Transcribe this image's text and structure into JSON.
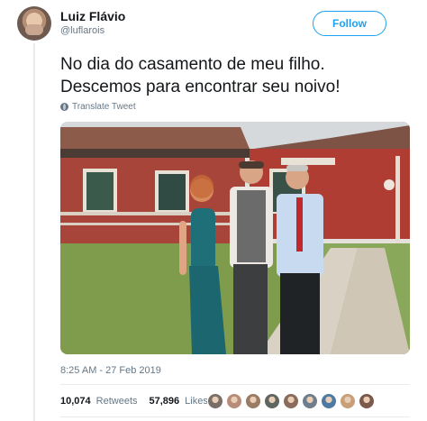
{
  "user": {
    "name": "Luiz Flávio",
    "handle": "@luflarois",
    "follow_label": "Follow"
  },
  "tweet": {
    "text": "No dia do casamento de meu filho. Descemos para encontrar seu noivo!",
    "translate_label": "Translate Tweet",
    "timestamp": "8:25 AM - 27 Feb 2019"
  },
  "stats": {
    "retweets_count": "10,074",
    "retweets_label": "Retweets",
    "likes_count": "57,896",
    "likes_label": "Likes"
  },
  "likers": [
    {
      "color": "#7a6f68"
    },
    {
      "color": "#b98c7a"
    },
    {
      "color": "#9a7b63"
    },
    {
      "color": "#5f6660"
    },
    {
      "color": "#8a6b5c"
    },
    {
      "color": "#6f7d8c"
    },
    {
      "color": "#4d7aa3"
    },
    {
      "color": "#c7a07a"
    },
    {
      "color": "#7b5a4c"
    }
  ],
  "colors": {
    "accent": "#1da1f2",
    "muted_text": "#657786",
    "divider": "#e6ecf0"
  },
  "icons": {
    "translate": "globe-icon"
  }
}
